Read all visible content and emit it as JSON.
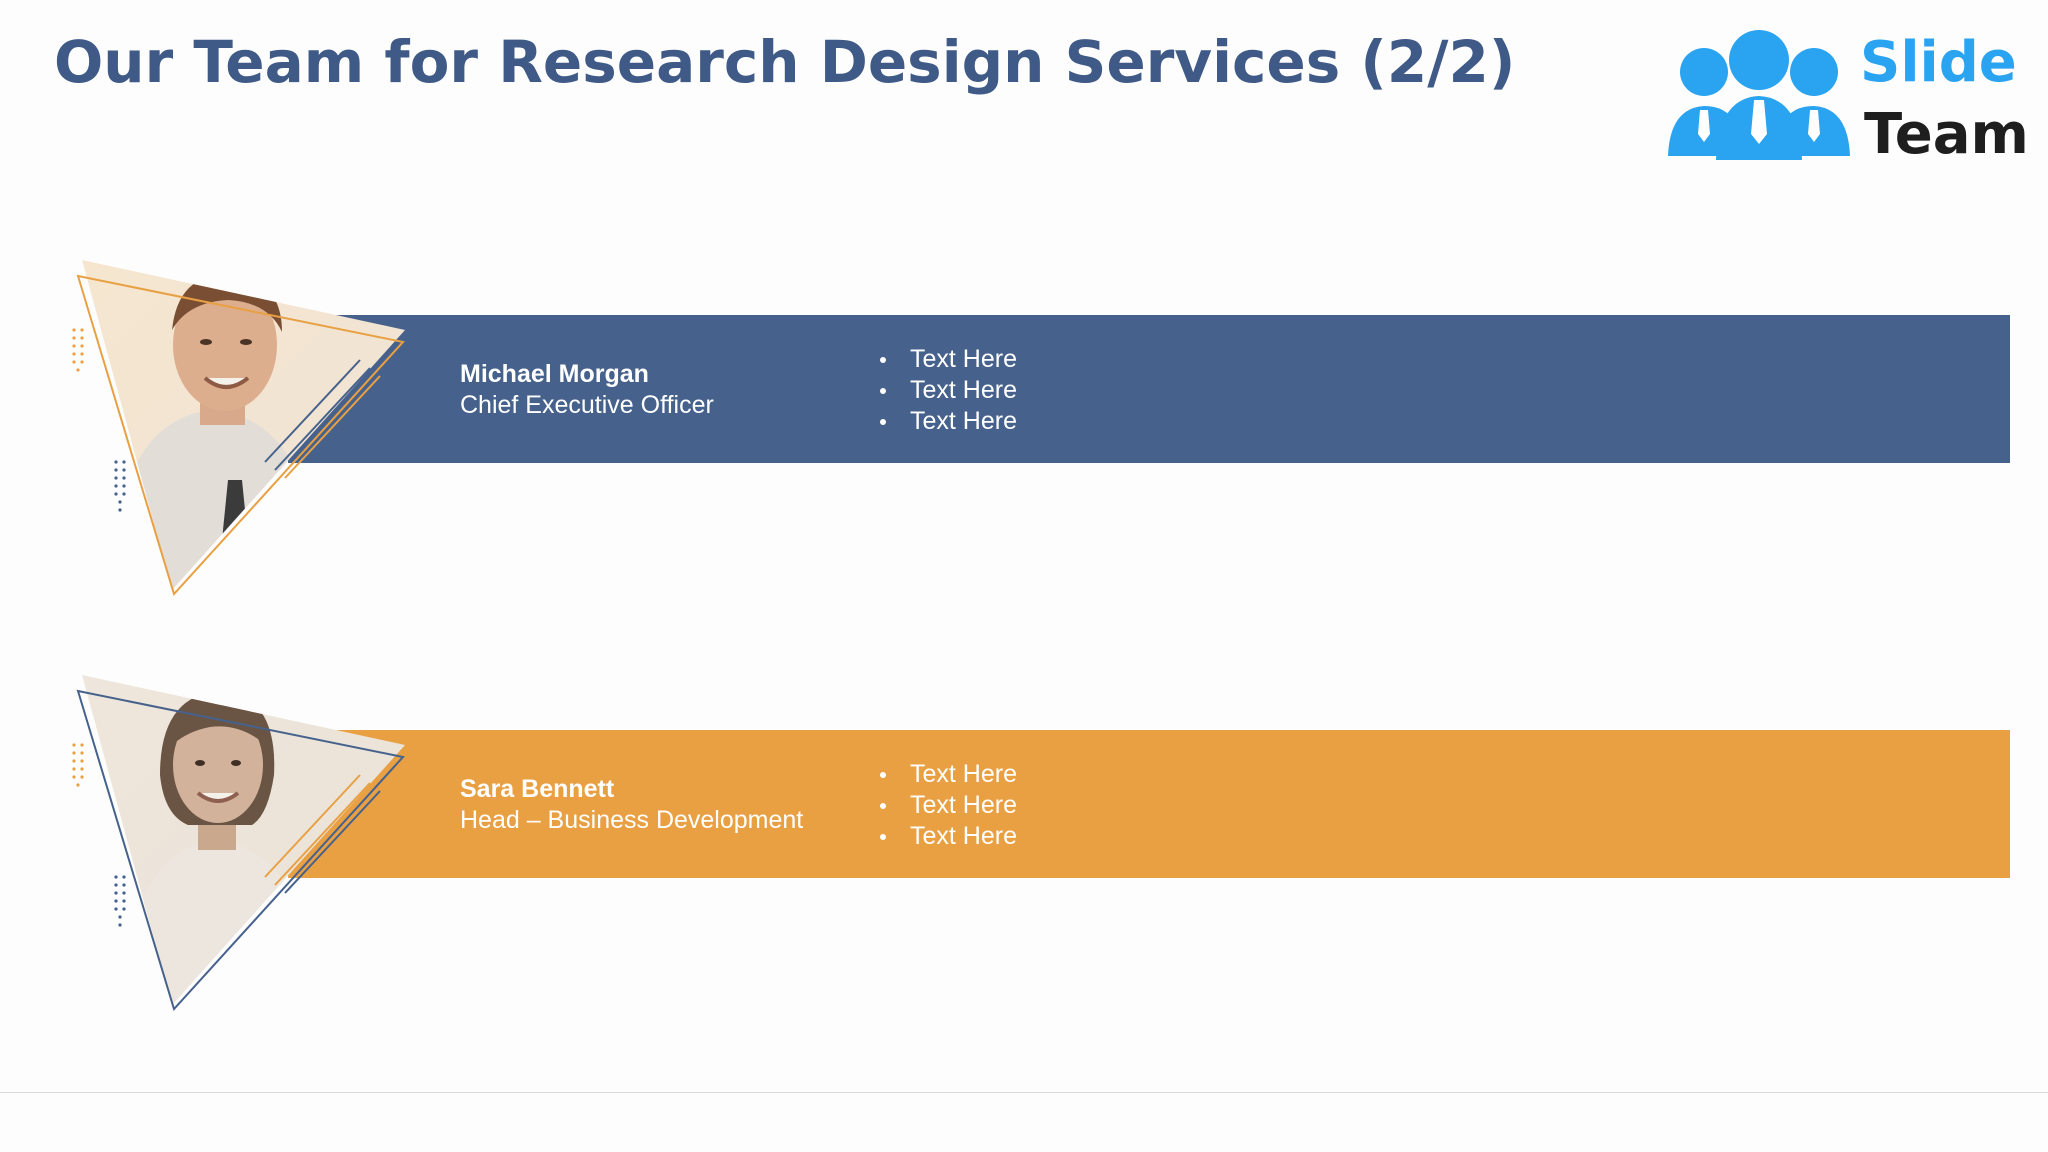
{
  "slide": {
    "title": "Our Team for Research Design Services (2/2)"
  },
  "logo": {
    "line1": "Slide",
    "line2": "Team",
    "color_primary": "#2aa3f0",
    "color_text": "#1e1e1e"
  },
  "members": [
    {
      "name": "Michael Morgan",
      "role": "Chief Executive Officer",
      "band_color": "#46628c",
      "bullets": [
        "Text Here",
        "Text Here",
        "Text Here"
      ]
    },
    {
      "name": "Sara Bennett",
      "role": "Head – Business Development",
      "band_color": "#e8a043",
      "bullets": [
        "Text Here",
        "Text Here",
        "Text Here"
      ]
    }
  ],
  "colors": {
    "title": "#3f5a86",
    "accent_orange": "#e8a043",
    "accent_blue": "#46628c"
  }
}
